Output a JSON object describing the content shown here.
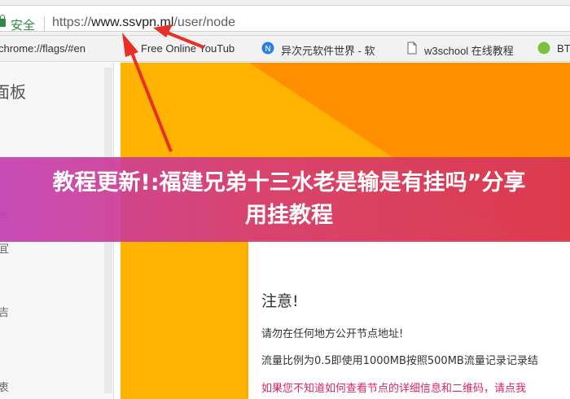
{
  "address_bar": {
    "secure_label": "安全",
    "url_prefix": "https://",
    "url_host": "www.ssvpn.ml",
    "url_path": "/user/node"
  },
  "bookmarks": [
    {
      "label": "chrome://flags/#en",
      "icon": "none"
    },
    {
      "label": "Free Online YouTub",
      "icon": "star-icon"
    },
    {
      "label": "异次元软件世界 - 软",
      "icon": "iplaysoft-icon"
    },
    {
      "label": "w3school 在线教程",
      "icon": "document-icon"
    },
    {
      "label": "BT",
      "icon": "leaf-icon"
    }
  ],
  "sidebar": {
    "title": "面板",
    "glyphs": [
      "息",
      "冝",
      "吉",
      "衷"
    ]
  },
  "card": {
    "title": "注意!",
    "lines": [
      "请勿在任何地方公开节点地址!",
      "流量比例为0.5即使用1000MB按照500MB流量记录记录结",
      "如果您不知道如何查看节点的详细信息和二维码，请点我"
    ]
  },
  "banner": {
    "title": "教程更新!:福建兄弟十三水老是输是有挂吗”分享用挂教程"
  },
  "colors": {
    "secure_green": "#2e8b3e",
    "page_yellow": "#ffb300",
    "page_orange": "#ff8f00",
    "arrow_red": "#e8302a",
    "card_red_text": "#e0245e"
  }
}
